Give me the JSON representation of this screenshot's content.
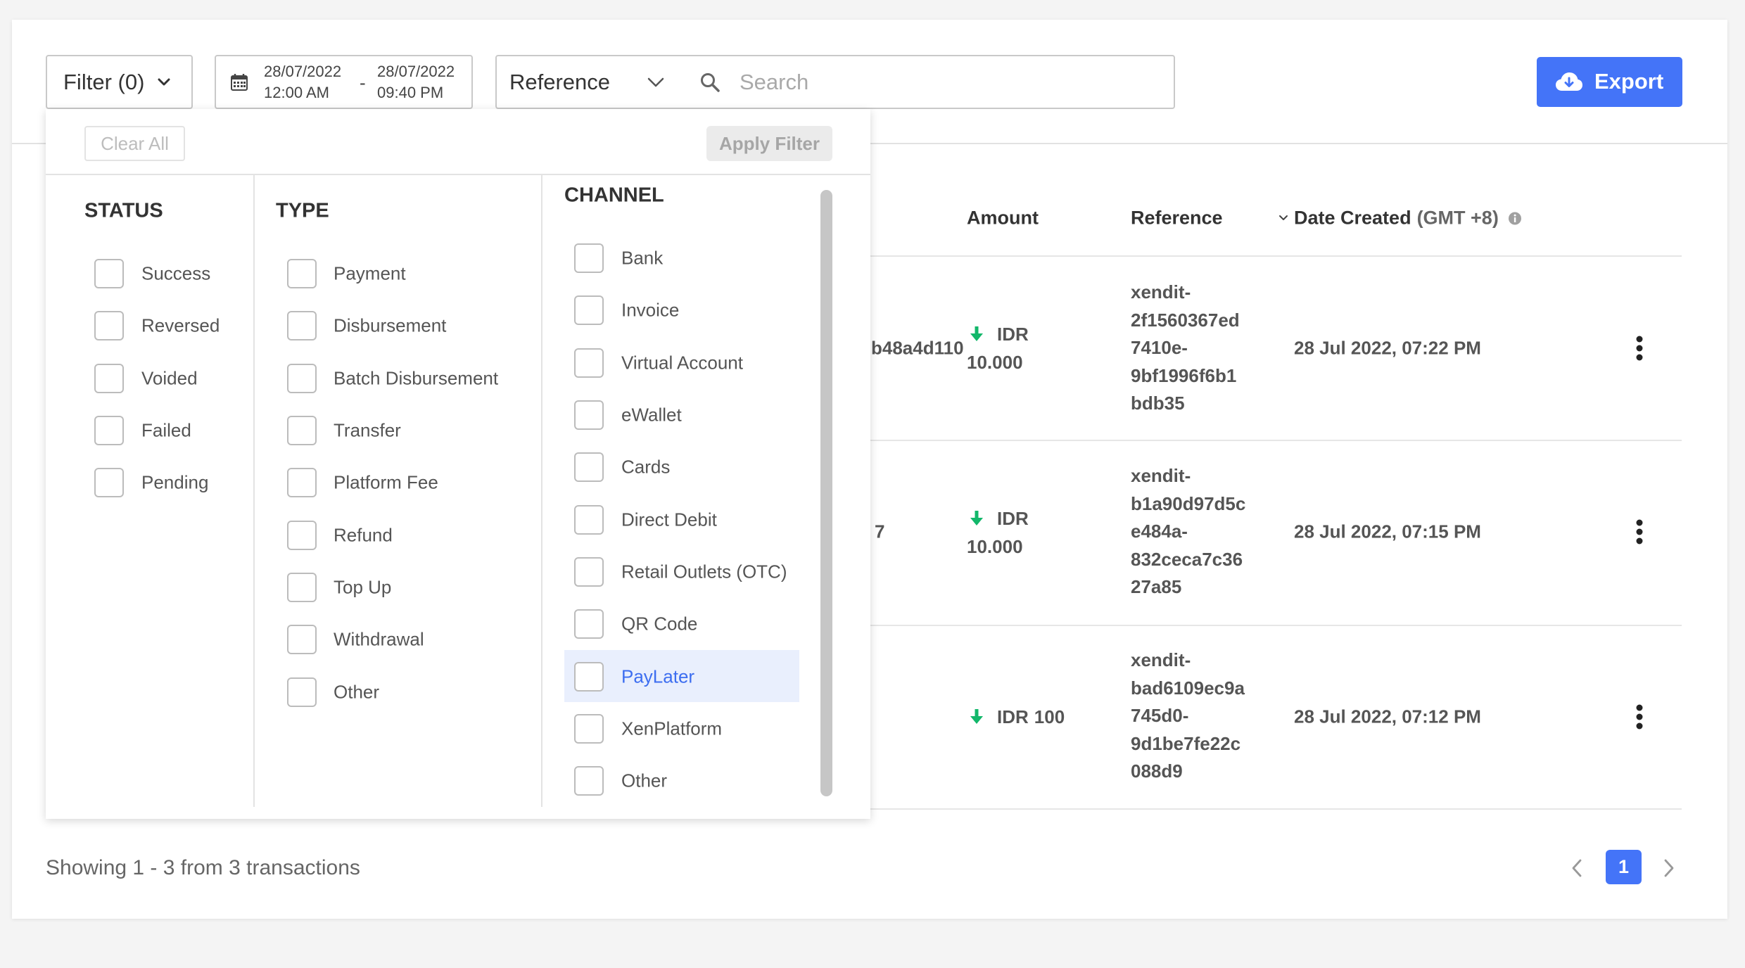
{
  "toolbar": {
    "filter_label": "Filter (0)",
    "date_range": {
      "start_date": "28/07/2022",
      "start_time": "12:00 AM",
      "separator": "-",
      "end_date": "28/07/2022",
      "end_time": "09:40 PM"
    },
    "search_field": "Reference",
    "search_placeholder": "Search",
    "export_label": "Export",
    "icons": {
      "filter": "chevron-down-icon",
      "date": "calendar-icon",
      "select": "chevron-down-icon",
      "search": "search-icon",
      "export": "cloud-download-icon"
    }
  },
  "filter_panel": {
    "clear_all": "Clear All",
    "apply_filter": "Apply Filter",
    "status": {
      "title": "STATUS",
      "options": [
        "Success",
        "Reversed",
        "Voided",
        "Failed",
        "Pending"
      ]
    },
    "type": {
      "title": "TYPE",
      "options": [
        "Payment",
        "Disbursement",
        "Batch Disbursement",
        "Transfer",
        "Platform Fee",
        "Refund",
        "Top Up",
        "Withdrawal",
        "Other"
      ]
    },
    "channel": {
      "title": "CHANNEL",
      "options": [
        "Bank",
        "Invoice",
        "Virtual Account",
        "eWallet",
        "Cards",
        "Direct Debit",
        "Retail Outlets (OTC)",
        "QR Code",
        "PayLater",
        "XenPlatform",
        "Other"
      ],
      "hovered": "PayLater"
    },
    "checked": []
  },
  "table": {
    "headers": {
      "amount": "Amount",
      "reference": "Reference",
      "date_created": "Date Created",
      "timezone": "(GMT +8)"
    },
    "rows": [
      {
        "id": "b48a4d110",
        "amount": {
          "currency": "IDR",
          "value": "10.000",
          "icon": "arrow-down-icon"
        },
        "reference_lines": [
          "xendit-",
          "2f1560367ed",
          "7410e-",
          "9bf1996f6b1",
          "bdb35"
        ],
        "date_created": "28 Jul 2022, 07:22 PM"
      },
      {
        "id": "7",
        "amount": {
          "currency": "IDR",
          "value": "10.000",
          "icon": "arrow-down-icon"
        },
        "reference_lines": [
          "xendit-",
          "b1a90d97d5c",
          "e484a-",
          "832ceca7c36",
          "27a85"
        ],
        "date_created": "28 Jul 2022, 07:15 PM"
      },
      {
        "amount": {
          "currency": "IDR",
          "value": "100",
          "icon": "arrow-down-icon"
        },
        "reference_lines": [
          "xendit-",
          "bad6109ec9a",
          "745d0-",
          "9d1be7fe22c",
          "088d9"
        ],
        "date_created": "28 Jul 2022, 07:12 PM"
      }
    ]
  },
  "footer": {
    "summary": "Showing 1 - 3 from 3 transactions",
    "current_page": "1"
  },
  "colors": {
    "accent": "#4474f8",
    "incoming": "#12b76a",
    "hover_bg": "#e9effd",
    "hover_text": "#3d6ef0"
  }
}
